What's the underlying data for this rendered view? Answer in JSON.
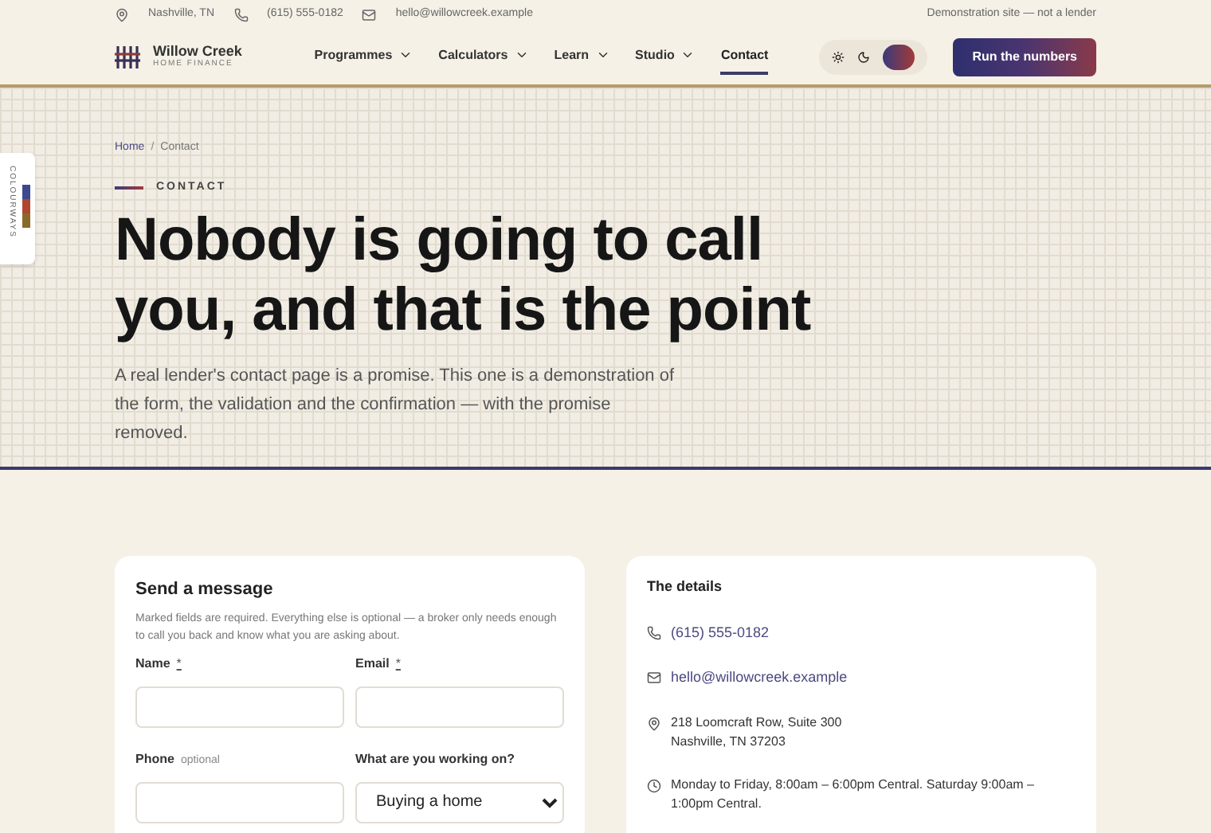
{
  "top_bar": {
    "location": "Nashville, TN",
    "phone": "(615) 555-0182",
    "email": "hello@willowcreek.example",
    "notice": "Demonstration site — not a lender"
  },
  "brand": {
    "name": "Willow Creek",
    "tagline": "HOME FINANCE"
  },
  "nav": [
    {
      "label": "Programmes",
      "dropdown": true,
      "selected": false
    },
    {
      "label": "Calculators",
      "dropdown": true,
      "selected": false
    },
    {
      "label": "Learn",
      "dropdown": true,
      "selected": false
    },
    {
      "label": "Studio",
      "dropdown": true,
      "selected": false
    },
    {
      "label": "Contact",
      "dropdown": false,
      "selected": true
    }
  ],
  "cta": "Run the numbers",
  "colourways": {
    "label": "COLOURWAYS",
    "swatches": [
      {
        "color": "#3b4a8c"
      },
      {
        "color": "#b0472f"
      },
      {
        "color": "#8a6a2a"
      }
    ]
  },
  "breadcrumb": {
    "separator": "/",
    "items": [
      {
        "label": "Home",
        "link": true
      },
      {
        "label": "Contact",
        "link": false
      }
    ]
  },
  "eyebrow": "CONTACT",
  "headline": "Nobody is going to call you, and that is the point",
  "intro": "A real lender's contact page is a promise. This one is a demonstration of the form, the validation and the confirmation — with the promise removed.",
  "form": {
    "title": "Send a message",
    "note": "Marked fields are required. Everything else is optional — a broker only needs enough to call you back and know what you are asking about.",
    "fields": [
      {
        "kind": "text",
        "label": "Name",
        "required_mark": "*"
      },
      {
        "kind": "text",
        "label": "Email",
        "required_mark": "*"
      },
      {
        "kind": "text",
        "label": "Phone",
        "hint": "optional"
      },
      {
        "kind": "select",
        "label": "What are you working on?",
        "value": "Buying a home"
      }
    ]
  },
  "details": {
    "title": "The details",
    "items": [
      {
        "kind": "phone",
        "lines": [
          "(615) 555-0182"
        ],
        "link": true
      },
      {
        "kind": "email",
        "lines": [
          "hello@willowcreek.example"
        ],
        "link": true
      },
      {
        "kind": "address",
        "lines": [
          "218 Loomcraft Row, Suite 300",
          "Nashville, TN 37203"
        ],
        "link": false
      },
      {
        "kind": "hours",
        "lines": [
          "Monday to Friday, 8:00am – 6:00pm Central. Saturday 9:00am – 1:00pm Central."
        ],
        "link": false
      }
    ]
  }
}
